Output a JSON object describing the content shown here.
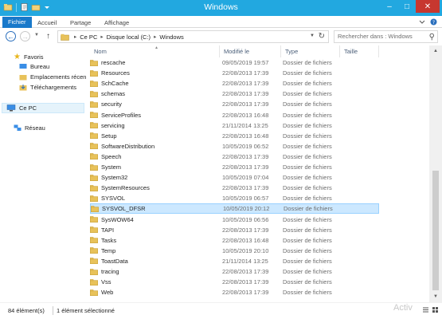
{
  "window": {
    "title": "Windows"
  },
  "ribbon": {
    "tabs": [
      "Fichier",
      "Accueil",
      "Partage",
      "Affichage"
    ]
  },
  "address": {
    "crumbs": [
      "Ce PC",
      "Disque local (C:)",
      "Windows"
    ],
    "search_placeholder": "Rechercher dans : Windows"
  },
  "nav": {
    "favorites_label": "Favoris",
    "favorites": [
      "Bureau",
      "Emplacements récen",
      "Téléchargements"
    ],
    "this_pc": "Ce PC",
    "network": "Réseau"
  },
  "columns": {
    "name": "Nom",
    "date": "Modifié le",
    "type": "Type",
    "size": "Taille"
  },
  "files": [
    {
      "name": "rescache",
      "date": "09/05/2019 19:57",
      "type": "Dossier de fichiers"
    },
    {
      "name": "Resources",
      "date": "22/08/2013 17:39",
      "type": "Dossier de fichiers"
    },
    {
      "name": "SchCache",
      "date": "22/08/2013 17:39",
      "type": "Dossier de fichiers"
    },
    {
      "name": "schemas",
      "date": "22/08/2013 17:39",
      "type": "Dossier de fichiers"
    },
    {
      "name": "security",
      "date": "22/08/2013 17:39",
      "type": "Dossier de fichiers"
    },
    {
      "name": "ServiceProfiles",
      "date": "22/08/2013 16:48",
      "type": "Dossier de fichiers"
    },
    {
      "name": "servicing",
      "date": "21/11/2014 13:25",
      "type": "Dossier de fichiers"
    },
    {
      "name": "Setup",
      "date": "22/08/2013 16:48",
      "type": "Dossier de fichiers"
    },
    {
      "name": "SoftwareDistribution",
      "date": "10/05/2019 06:52",
      "type": "Dossier de fichiers"
    },
    {
      "name": "Speech",
      "date": "22/08/2013 17:39",
      "type": "Dossier de fichiers"
    },
    {
      "name": "System",
      "date": "22/08/2013 17:39",
      "type": "Dossier de fichiers"
    },
    {
      "name": "System32",
      "date": "10/05/2019 07:04",
      "type": "Dossier de fichiers"
    },
    {
      "name": "SystemResources",
      "date": "22/08/2013 17:39",
      "type": "Dossier de fichiers"
    },
    {
      "name": "SYSVOL",
      "date": "10/05/2019 06:57",
      "type": "Dossier de fichiers"
    },
    {
      "name": "SYSVOL_DFSR",
      "date": "10/05/2019 20:12",
      "type": "Dossier de fichiers",
      "selected": true
    },
    {
      "name": "SysWOW64",
      "date": "10/05/2019 06:56",
      "type": "Dossier de fichiers"
    },
    {
      "name": "TAPI",
      "date": "22/08/2013 17:39",
      "type": "Dossier de fichiers"
    },
    {
      "name": "Tasks",
      "date": "22/08/2013 16:48",
      "type": "Dossier de fichiers"
    },
    {
      "name": "Temp",
      "date": "10/05/2019 20:10",
      "type": "Dossier de fichiers"
    },
    {
      "name": "ToastData",
      "date": "21/11/2014 13:25",
      "type": "Dossier de fichiers"
    },
    {
      "name": "tracing",
      "date": "22/08/2013 17:39",
      "type": "Dossier de fichiers"
    },
    {
      "name": "Vss",
      "date": "22/08/2013 17:39",
      "type": "Dossier de fichiers"
    },
    {
      "name": "Web",
      "date": "22/08/2013 17:39",
      "type": "Dossier de fichiers"
    }
  ],
  "status": {
    "count": "84 élément(s)",
    "selection": "1 élément sélectionné"
  },
  "watermark": "Activ",
  "colors": {
    "titlebar": "#22a8e0",
    "file_tab": "#1979ca",
    "folder": "#e8c25a",
    "selection": "#cce8ff"
  }
}
